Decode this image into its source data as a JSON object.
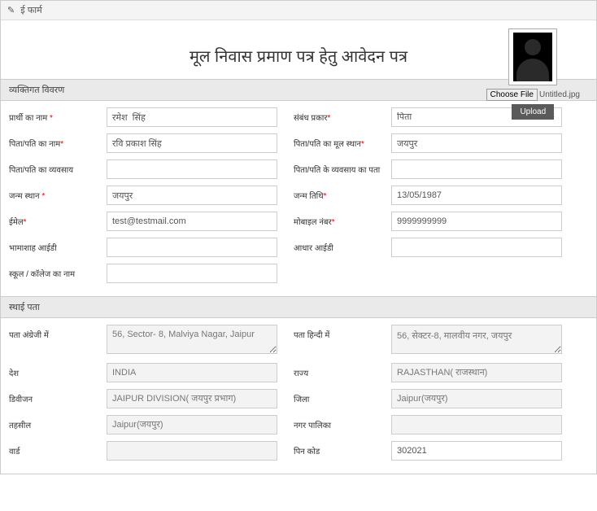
{
  "header": {
    "title": "ई फार्म"
  },
  "title_area": {
    "main_title": "मूल निवास प्रमाण पत्र हेतु आवेदन पत्र",
    "choose_file_label": "Choose File",
    "file_name": "Untitled.jpg",
    "upload_label": "Upload"
  },
  "sections": {
    "personal": "व्यक्तिगत विवरण",
    "address": "स्थाई पता"
  },
  "labels": {
    "applicant_name": "प्रार्थी का नाम",
    "relation_type": "संबंध प्रकार",
    "father_husband_name": "पिता/पति का नाम",
    "father_husband_native": "पिता/पति का मूल स्थान",
    "father_husband_occupation": "पिता/पति का व्यवसाय",
    "father_husband_occ_address": "पिता/पति के व्यवसाय का पता",
    "birth_place": "जन्म स्थान",
    "birth_date": "जन्म तिथि",
    "email": "ईमेल",
    "mobile": "मोबाइल नंबर",
    "bhamashah_id": "भामाशाह आईडी",
    "aadhar_id": "आधार आईडी",
    "school_college": "स्कूल / कॉलेज का नाम",
    "address_en": "पता अंग्रेजी में",
    "address_hi": "पता हिन्दी में",
    "country": "देश",
    "state": "राज्य",
    "division": "डिवीजन",
    "district": "जिला",
    "tehsil": "तहसील",
    "municipality": "नगर पालिका",
    "ward": "वार्ड",
    "pincode": "पिन कोड"
  },
  "values": {
    "applicant_name": "रमेश  सिंह",
    "relation_type": "पिता",
    "father_husband_name": "रवि प्रकाश सिंह",
    "father_husband_native": "जयपुर",
    "father_husband_occupation": "",
    "father_husband_occ_address": "",
    "birth_place": "जयपुर",
    "birth_date": "13/05/1987",
    "email": "test@testmail.com",
    "mobile": "9999999999",
    "bhamashah_id": "",
    "aadhar_id": "",
    "school_college": "",
    "address_en": "56, Sector- 8, Malviya Nagar, Jaipur",
    "address_hi": "56, सेक्टर-8, मालवीय नगर, जयपुर",
    "country": "INDIA",
    "state": "RAJASTHAN( राजस्थान)",
    "division": "JAIPUR DIVISION( जयपुर प्रभाग)",
    "district": "Jaipur(जयपुर)",
    "tehsil": "Jaipur(जयपुर)",
    "municipality": "",
    "ward": "",
    "pincode": "302021"
  }
}
